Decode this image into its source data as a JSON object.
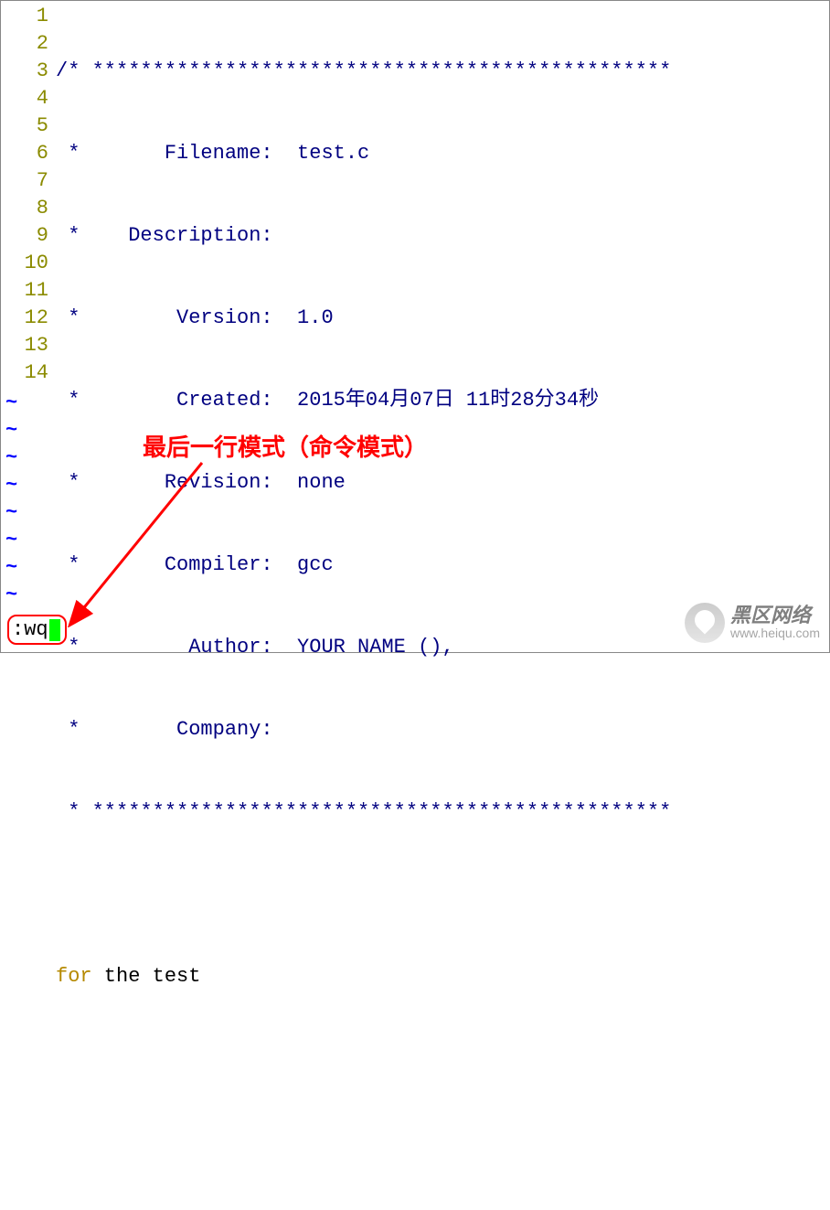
{
  "gutter": [
    "1",
    "2",
    "3",
    "4",
    "5",
    "6",
    "7",
    "8",
    "9",
    "10",
    "11",
    "12",
    "13",
    "14"
  ],
  "code": {
    "l1_open": "/* ",
    "l1_stars": "************************************************",
    "l2": " *       Filename:  test.c",
    "l3": " *    Description:  ",
    "l4": " *        Version:  1.0",
    "l5": " *        Created:  2015年04月07日 11时28分34秒",
    "l6": " *       Revision:  none",
    "l7": " *       Compiler:  gcc",
    "l8": " *         Author:  YOUR NAME (), ",
    "l9": " *        Company:  ",
    "l10_pre": " * ",
    "l10_stars": "************************************************",
    "l11": "",
    "l12_kw": "for",
    "l12_rest": " the test",
    "l13": "",
    "l14": ""
  },
  "tilde": "~",
  "command": ":wq",
  "annotation": "最后一行模式（命令模式）",
  "watermark": {
    "title": "黑区网络",
    "url": "www.heiqu.com"
  }
}
